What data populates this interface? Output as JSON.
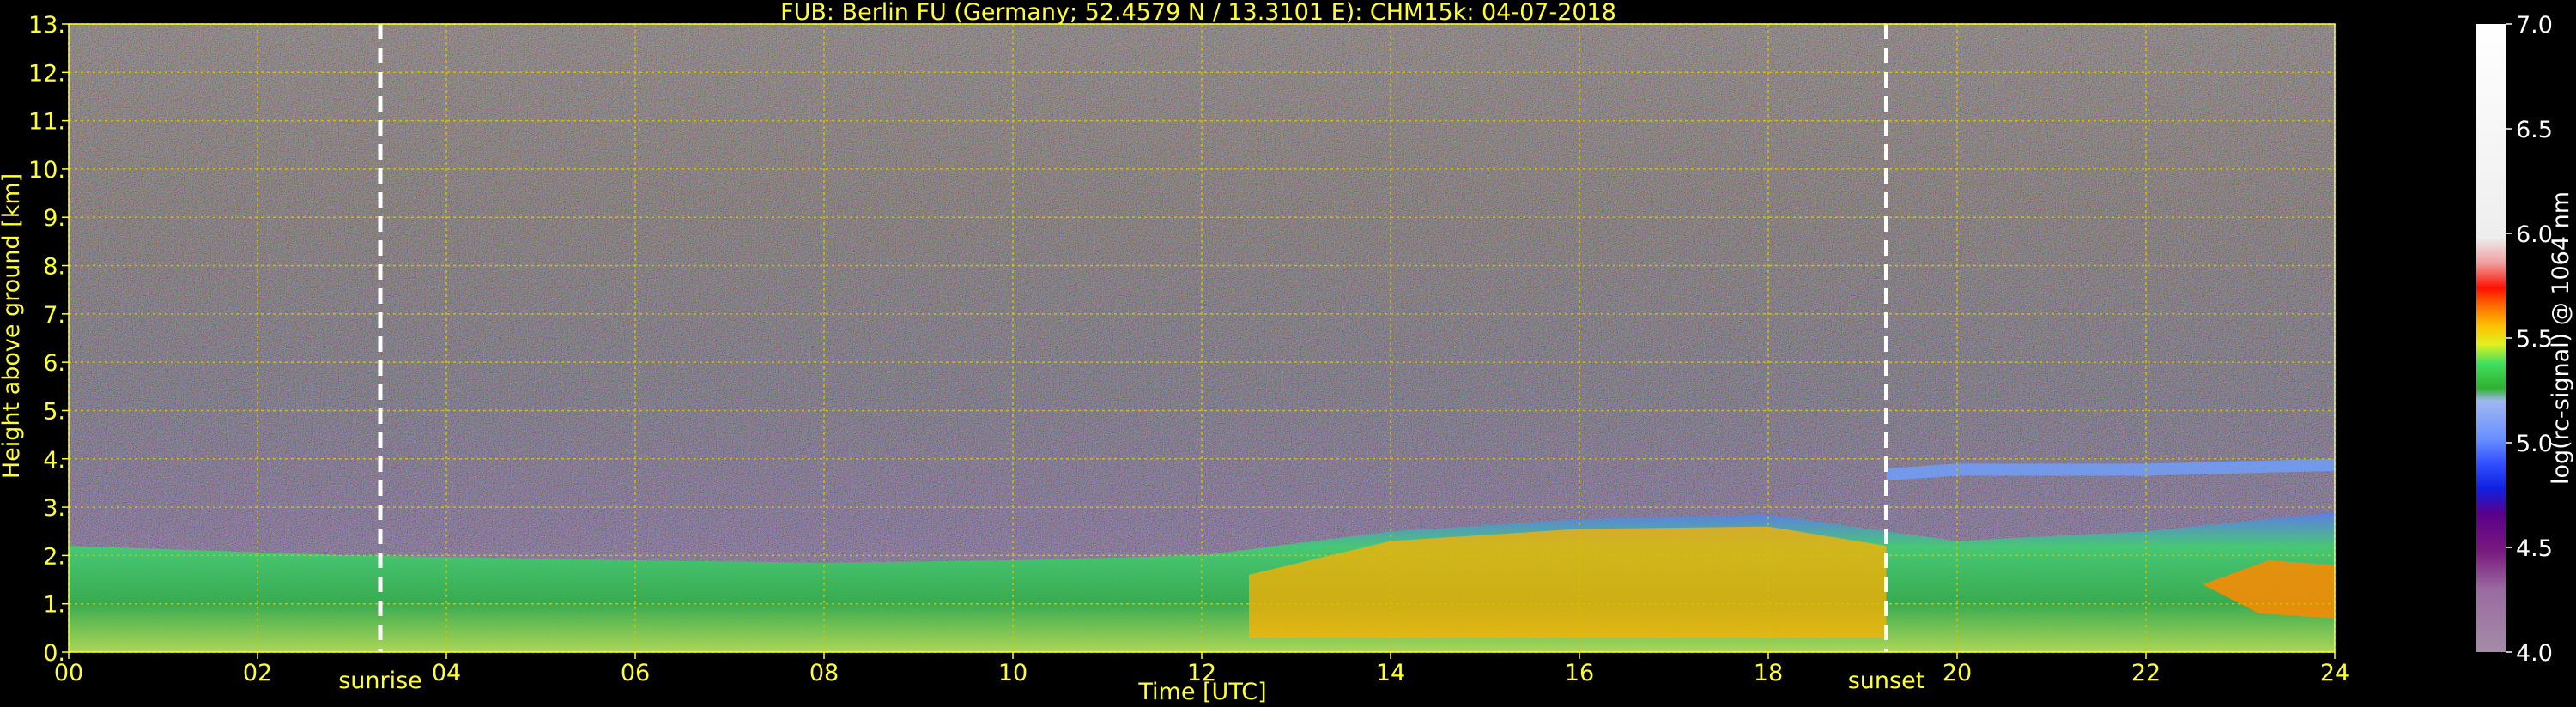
{
  "chart_data": {
    "type": "heatmap",
    "title": "FUB: Berlin FU (Germany; 52.4579 N / 13.3101 E):    CHM15k: 04-07-2018",
    "xlabel": "Time [UTC]",
    "ylabel": "Height above ground [km]",
    "xlim": [
      0,
      24
    ],
    "ylim": [
      0,
      13
    ],
    "x_ticks": [
      "00",
      "02",
      "04",
      "06",
      "08",
      "10",
      "12",
      "14",
      "16",
      "18",
      "20",
      "22",
      "24"
    ],
    "y_ticks": [
      "0.",
      "1.",
      "2.",
      "3.",
      "4.",
      "5.",
      "6.",
      "7.",
      "8.",
      "9.",
      "10.",
      "11.",
      "12.",
      "13."
    ],
    "grid": true,
    "events": [
      {
        "label": "sunrise",
        "x": 3.3
      },
      {
        "label": "sunset",
        "x": 19.25
      }
    ],
    "colorbar": {
      "label": "log(rc-signal) @ 1064 nm",
      "range": [
        4.0,
        7.0
      ],
      "ticks": [
        "4.0",
        "4.5",
        "5.0",
        "5.5",
        "6.0",
        "6.5",
        "7.0"
      ]
    },
    "layers": [
      {
        "name": "boundary-layer-top",
        "x": [
          0,
          3,
          6,
          8,
          10,
          12,
          14,
          16,
          18,
          19.25,
          20,
          22,
          24
        ],
        "y": [
          2.2,
          2.0,
          1.9,
          1.85,
          1.9,
          2.0,
          2.5,
          2.75,
          2.85,
          2.5,
          2.3,
          2.5,
          2.9
        ]
      },
      {
        "name": "residual-layer",
        "x": [
          19.25,
          20,
          22,
          24
        ],
        "y": [
          3.8,
          3.9,
          3.9,
          4.0
        ]
      }
    ]
  },
  "colors": {
    "text": "#ffff33",
    "background": "#000000",
    "grid": "#d4c000",
    "event_line": "#ffffff"
  }
}
